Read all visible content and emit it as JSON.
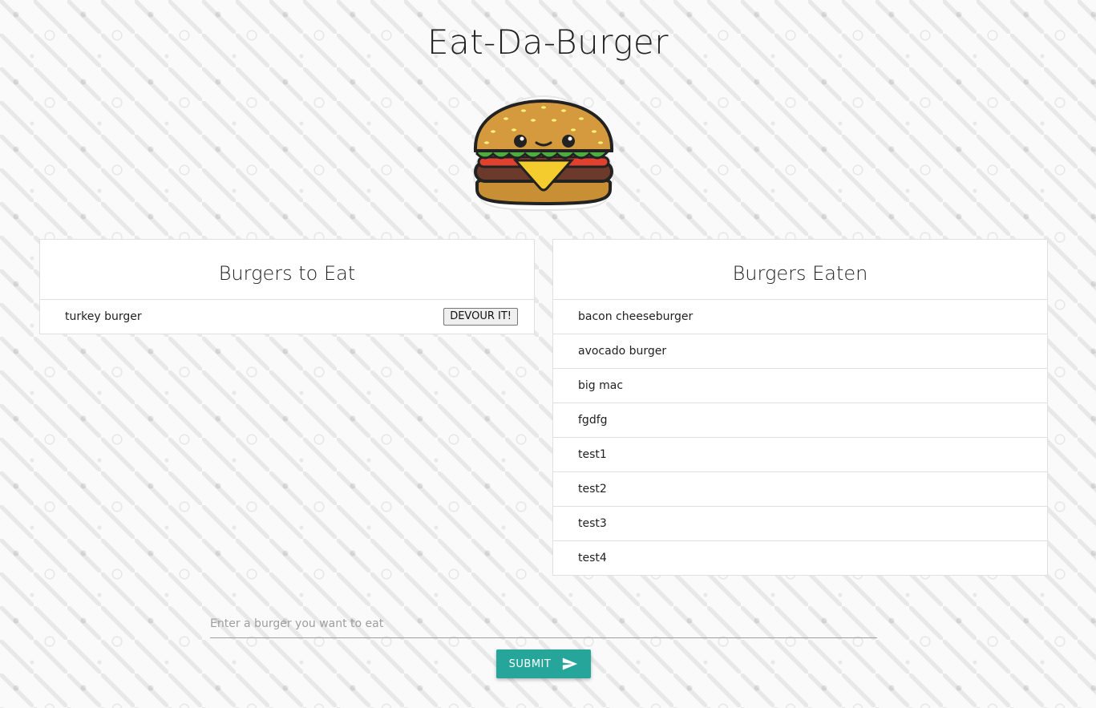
{
  "header": {
    "title": "Eat-Da-Burger"
  },
  "to_eat": {
    "title": "Burgers to Eat",
    "button_label": "DEVOUR IT!",
    "items": [
      "turkey burger"
    ]
  },
  "eaten": {
    "title": "Burgers Eaten",
    "items": [
      "bacon cheeseburger",
      "avocado burger",
      "big mac",
      "fgdfg",
      "test1",
      "test2",
      "test3",
      "test4"
    ]
  },
  "form": {
    "placeholder": "Enter a burger you want to eat",
    "value": "",
    "submit_label": "SUBMIT"
  },
  "icons": {
    "logo": "burger-logo",
    "submit": "send-icon"
  },
  "colors": {
    "accent": "#26a69a",
    "background": "#fafafa"
  }
}
